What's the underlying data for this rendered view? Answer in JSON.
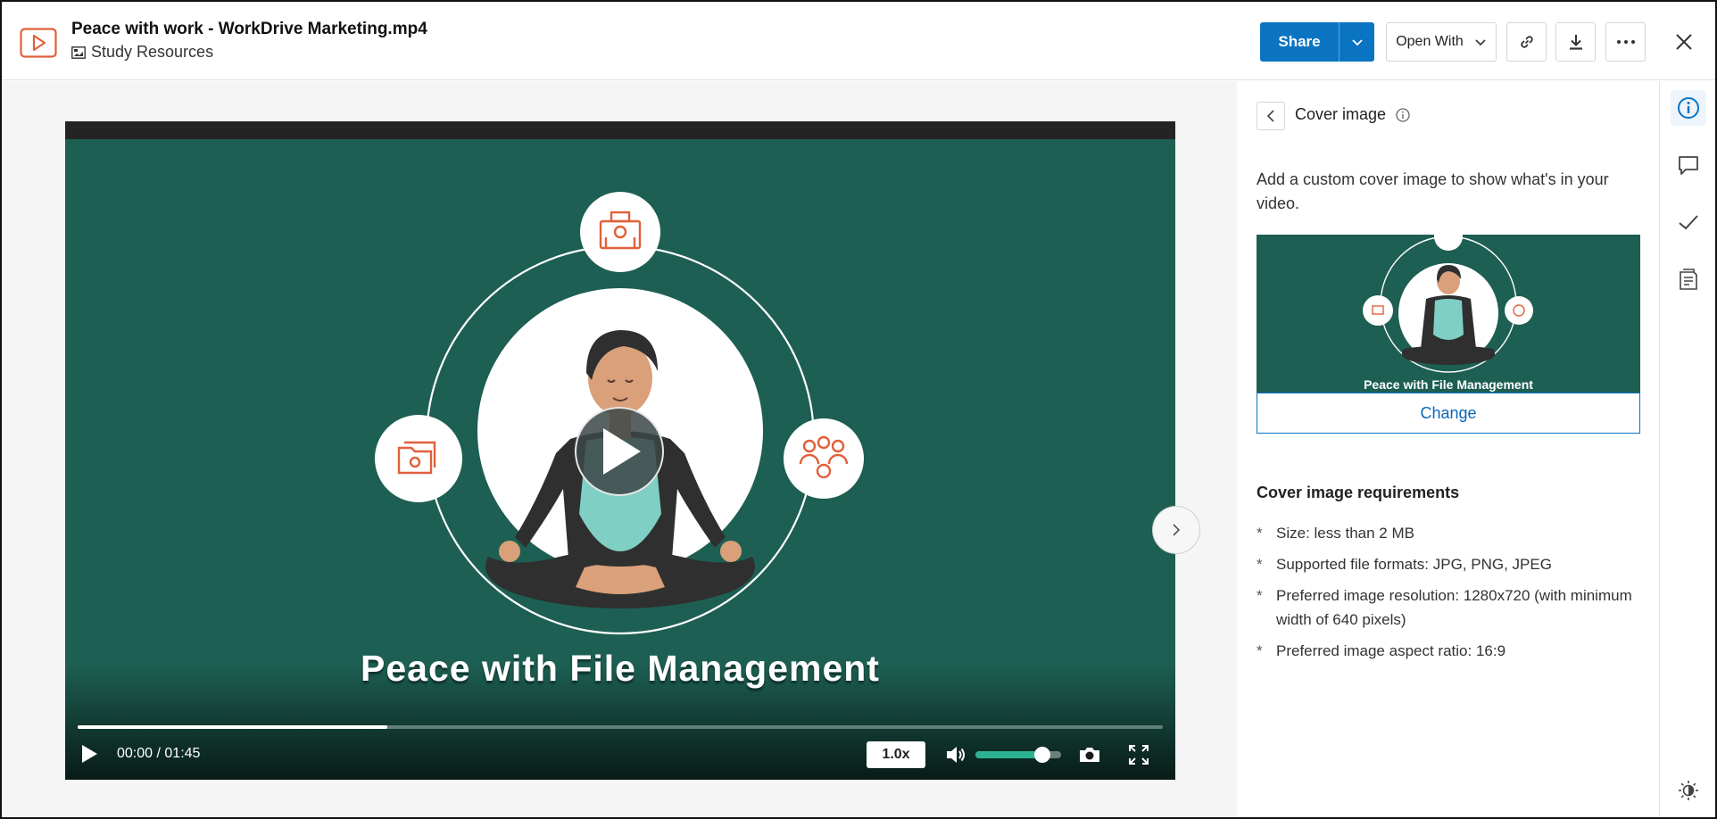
{
  "header": {
    "file_name": "Peace with work - WorkDrive Marketing.mp4",
    "folder_name": "Study Resources",
    "share_label": "Share",
    "open_with_label": "Open With",
    "icons": [
      "video-file-icon",
      "folder-icon",
      "chevron-down-icon",
      "link-icon",
      "download-icon",
      "more-icon",
      "close-icon"
    ]
  },
  "video": {
    "caption": "Peace with File Management",
    "current_time": "00:00",
    "time_separator": "/",
    "duration": "01:45",
    "speed": "1.0x",
    "buffered_fraction": 0.285,
    "volume_fraction": 0.78
  },
  "panel": {
    "title": "Cover image",
    "description": "Add a custom cover image to show what's in your video.",
    "thumbnail_caption": "Peace with File Management",
    "change_label": "Change",
    "requirements_title": "Cover image requirements",
    "bullet": "*",
    "requirements": [
      "Size: less than 2 MB",
      "Supported file formats: JPG, PNG, JPEG",
      "Preferred image resolution: 1280x720 (with minimum width of 640 pixels)",
      "Preferred image aspect ratio: 16:9"
    ]
  },
  "rail": {
    "icons": [
      "info-icon",
      "comment-icon",
      "checkmark-icon",
      "documents-icon",
      "theme-toggle-icon"
    ]
  },
  "colors": {
    "accent": "#0a74c2",
    "video_bg": "#1d5f52",
    "art_orange": "#e0603a",
    "volume": "#2bb394"
  }
}
